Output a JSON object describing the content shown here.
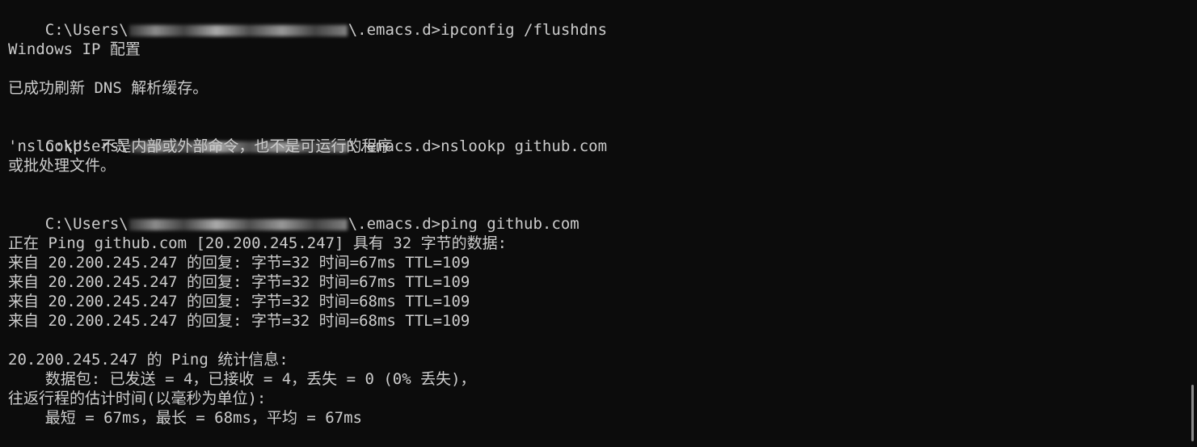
{
  "terminal": {
    "lines": {
      "l1_prefix": "C:\\Users\\",
      "l1_suffix": "\\.emacs.d>ipconfig /flushdns",
      "l2": "Windows IP 配置",
      "l3": "已成功刷新 DNS 解析缓存。",
      "l4_prefix": "C:\\Users\\",
      "l4_suffix": "\\.emacs.d>nslookp github.com",
      "l5": "'nslookp' 不是内部或外部命令，也不是可运行的程序",
      "l6": "或批处理文件。",
      "l7_prefix": "C:\\Users\\",
      "l7_suffix": "\\.emacs.d>ping github.com",
      "l8": "正在 Ping github.com [20.200.245.247] 具有 32 字节的数据:",
      "l9": "来自 20.200.245.247 的回复: 字节=32 时间=67ms TTL=109",
      "l10": "来自 20.200.245.247 的回复: 字节=32 时间=67ms TTL=109",
      "l11": "来自 20.200.245.247 的回复: 字节=32 时间=68ms TTL=109",
      "l12": "来自 20.200.245.247 的回复: 字节=32 时间=68ms TTL=109",
      "l13": "20.200.245.247 的 Ping 统计信息:",
      "l14": "    数据包: 已发送 = 4，已接收 = 4，丢失 = 0 (0% 丢失)，",
      "l15": "往返行程的估计时间(以毫秒为单位):",
      "l16": "    最短 = 67ms，最长 = 68ms，平均 = 67ms"
    }
  },
  "colors": {
    "background": "#0c0c0c",
    "text": "#cccccc"
  }
}
